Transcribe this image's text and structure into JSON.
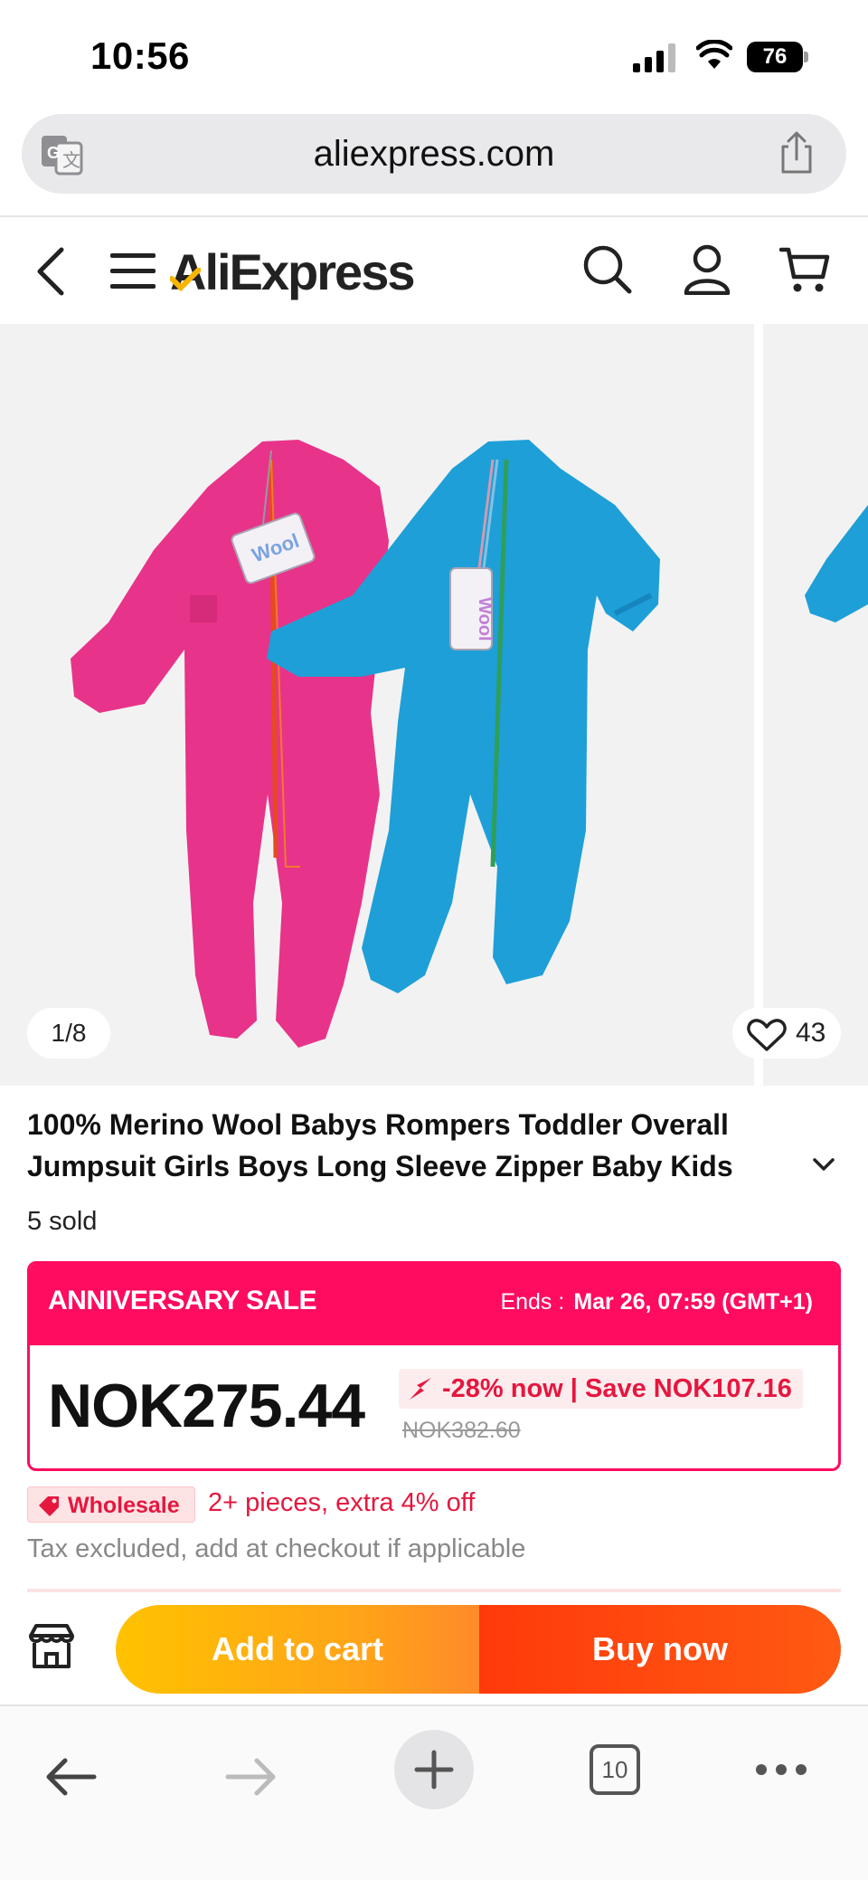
{
  "status_bar": {
    "time": "10:56",
    "battery": "76"
  },
  "browser": {
    "url": "aliexpress.com",
    "tab_count": "10"
  },
  "header": {
    "logo_text": "AliExpress"
  },
  "gallery": {
    "counter": "1/8",
    "wishlist_count": "43"
  },
  "product": {
    "title": "100% Merino Wool Babys Rompers Toddler Overall Jumpsuit Girls Boys Long Sleeve Zipper Baby Kids",
    "sold": "5 sold"
  },
  "sale": {
    "title": "ANNIVERSARY SALE",
    "ends_label": "Ends :",
    "ends_value": "Mar 26, 07:59 (GMT+1)",
    "price": "NOK275.44",
    "discount": "-28% now | Save NOK107.16",
    "original_price": "NOK382.60"
  },
  "wholesale": {
    "label": "Wholesale",
    "offer": "2+ pieces, extra 4% off"
  },
  "tax_note": "Tax excluded, add at checkout if applicable",
  "actions": {
    "add_to_cart": "Add to cart",
    "buy_now": "Buy now"
  },
  "colors": {
    "sale_pink": "#ff0b5f",
    "price_red": "#e5173f",
    "cart_orange": "#ffa21a",
    "buy_red": "#ff3a0a",
    "romper_pink": "#e8338a",
    "romper_blue": "#1e9fd8"
  },
  "icons": [
    "translate-icon",
    "share-icon",
    "back-icon",
    "menu-icon",
    "search-icon",
    "user-icon",
    "cart-icon",
    "heart-icon",
    "chevron-down-icon",
    "discount-arrow-icon",
    "tag-icon",
    "store-icon",
    "plus-icon",
    "more-icon"
  ]
}
